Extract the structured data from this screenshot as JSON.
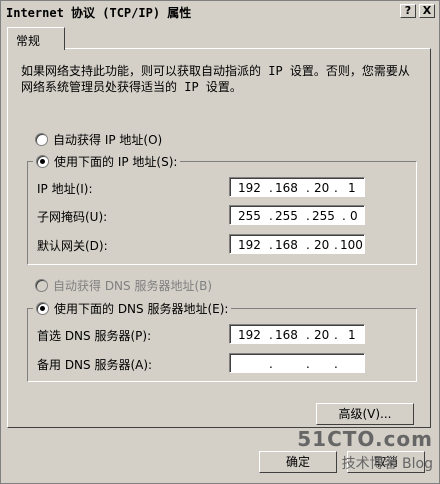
{
  "window": {
    "title": "Internet 协议 (TCP/IP) 属性",
    "help_label": "?",
    "close_label": "X"
  },
  "tabs": [
    {
      "label": "常规"
    }
  ],
  "intro": "如果网络支持此功能，则可以获取自动指派的 IP 设置。否则，您需要从网络系统管理员处获得适当的 IP 设置。",
  "ip_section": {
    "auto_label": "自动获得 IP 地址(O)",
    "manual_label": "使用下面的 IP 地址(S):",
    "selected": "manual",
    "fields": [
      {
        "label": "IP 地址(I):",
        "octets": [
          "192",
          "168",
          "20",
          "1"
        ]
      },
      {
        "label": "子网掩码(U):",
        "octets": [
          "255",
          "255",
          "255",
          "0"
        ]
      },
      {
        "label": "默认网关(D):",
        "octets": [
          "192",
          "168",
          "20",
          "100"
        ]
      }
    ]
  },
  "dns_section": {
    "auto_label": "自动获得 DNS 服务器地址(B)",
    "manual_label": "使用下面的 DNS 服务器地址(E):",
    "selected": "manual",
    "fields": [
      {
        "label": "首选 DNS 服务器(P):",
        "octets": [
          "192",
          "168",
          "20",
          "1"
        ]
      },
      {
        "label": "备用 DNS 服务器(A):",
        "octets": [
          "",
          "",
          "",
          ""
        ]
      }
    ]
  },
  "buttons": {
    "advanced": "高级(V)...",
    "ok": "确定",
    "cancel": "取消"
  },
  "watermark": {
    "line1": "51CTO.com",
    "line2": "技术博客 Blog"
  }
}
